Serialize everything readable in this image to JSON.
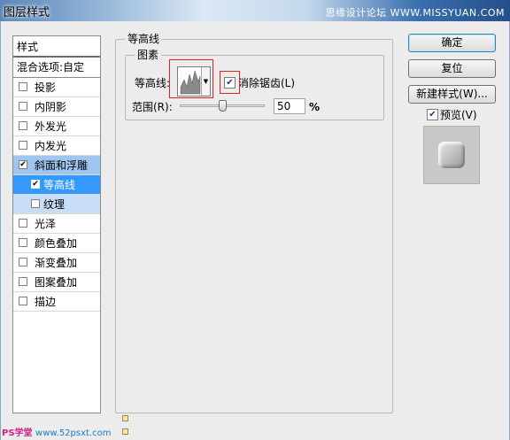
{
  "window": {
    "title": "图层样式",
    "watermark_top": "思缘设计论坛 WWW.MISSYUAN.COM"
  },
  "styles_panel": {
    "header": "样式",
    "blend_options": "混合选项:自定",
    "items": [
      {
        "label": "投影",
        "checked": false
      },
      {
        "label": "内阴影",
        "checked": false
      },
      {
        "label": "外发光",
        "checked": false
      },
      {
        "label": "内发光",
        "checked": false
      },
      {
        "label": "斜面和浮雕",
        "checked": true,
        "selected": true
      },
      {
        "label": "等高线",
        "checked": true,
        "sub": true,
        "active": true
      },
      {
        "label": "纹理",
        "checked": false,
        "sub": true
      },
      {
        "label": "光泽",
        "checked": false
      },
      {
        "label": "颜色叠加",
        "checked": false
      },
      {
        "label": "渐变叠加",
        "checked": false
      },
      {
        "label": "图案叠加",
        "checked": false
      },
      {
        "label": "描边",
        "checked": false
      }
    ]
  },
  "contour_section": {
    "group_title": "等高线",
    "elements_title": "图素",
    "contour_label": "等高线:",
    "antialias_label": "消除锯齿(L)",
    "antialias_checked": true,
    "range_label": "范围(R):",
    "range_value": "50",
    "range_unit": "%",
    "range_fraction": 0.5
  },
  "buttons": {
    "ok": "确定",
    "reset": "复位",
    "new_style": "新建样式(W)...",
    "preview_label": "预览(V)",
    "preview_checked": true
  },
  "watermark_bottom": {
    "brand": "PS学堂",
    "url": "www.52psxt.com"
  }
}
